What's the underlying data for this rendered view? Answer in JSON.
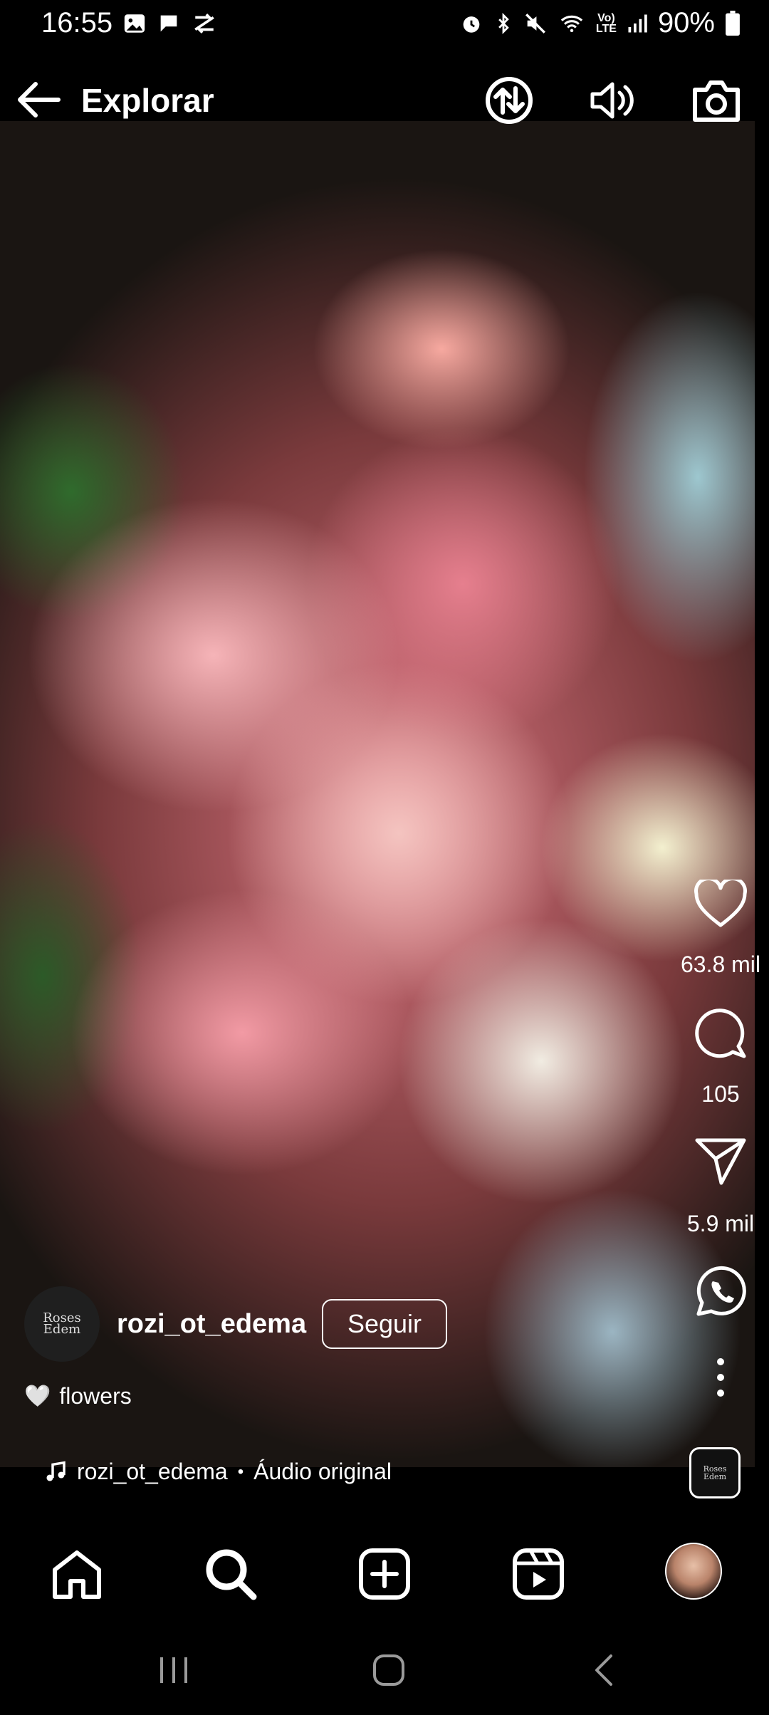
{
  "status_bar": {
    "time": "16:55",
    "battery": "90%",
    "network": "LTE",
    "left_icons": [
      "image-icon",
      "chat-bubble-icon",
      "sync-icon"
    ],
    "right_icons": [
      "alarm-icon",
      "bluetooth-icon",
      "mute-icon",
      "wifi-icon",
      "volte-icon",
      "signal-icon",
      "battery-icon"
    ]
  },
  "header": {
    "title": "Explorar",
    "icons": [
      "back-arrow-icon",
      "data-saver-icon",
      "volume-icon",
      "camera-icon"
    ]
  },
  "reel": {
    "likes": "63.8 mil",
    "comments": "105",
    "shares": "5.9 mil",
    "author": {
      "username": "rozi_ot_edema",
      "follow_label": "Seguir",
      "avatar_text": "Roses Edem"
    },
    "caption": {
      "emoji": "🤍",
      "text": "flowers"
    },
    "audio": {
      "author": "rozi_ot_edema",
      "separator": "•",
      "title": "Áudio original"
    }
  },
  "bottom_nav": [
    "home-icon",
    "search-icon",
    "create-icon",
    "reels-icon",
    "profile-avatar"
  ],
  "colors": {
    "background": "#000000",
    "text": "#ffffff"
  }
}
